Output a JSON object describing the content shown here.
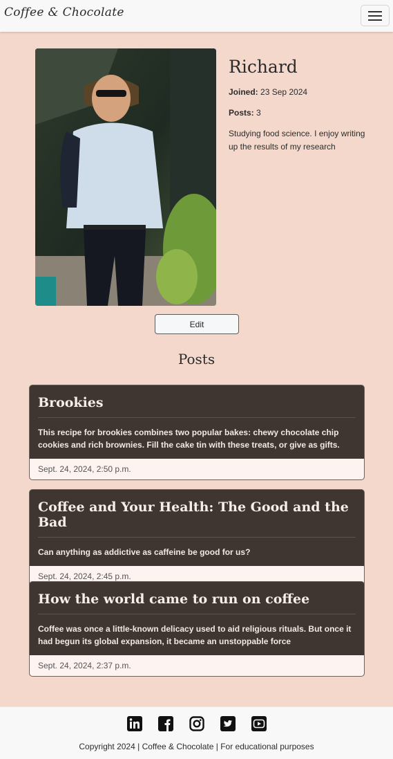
{
  "navbar": {
    "brand": "Coffee & Chocolate",
    "toggler_icon": "hamburger-icon"
  },
  "profile": {
    "name": "Richard",
    "joined_label": "Joined:",
    "joined_value": "23 Sep 2024",
    "posts_label": "Posts:",
    "posts_value": "3",
    "bio": "Studying food science. I enjoy writing up the results of my research",
    "edit_label": "Edit"
  },
  "posts_heading": "Posts",
  "posts": [
    {
      "title": "Brookies",
      "excerpt": "This recipe for brookies combines two popular bakes: chewy chocolate chip cookies and rich brownies. Fill the cake tin with these treats, or give as gifts.",
      "date": "Sept. 24, 2024, 2:50 p.m."
    },
    {
      "title": "Coffee and Your Health: The Good and the Bad",
      "excerpt": "Can anything as addictive as caffeine be good for us?",
      "date": "Sept. 24, 2024, 2:45 p.m."
    },
    {
      "title": "How the world came to run on coffee",
      "excerpt": "Coffee was once a little-known delicacy used to aid religious rituals. But once it had begun its global expansion, it became an unstoppable force",
      "date": "Sept. 24, 2024, 2:37 p.m."
    }
  ],
  "footer": {
    "socials": [
      "linkedin-icon",
      "facebook-icon",
      "instagram-icon",
      "twitter-icon",
      "youtube-icon"
    ],
    "copyright": "Copyright 2024 | Coffee & Chocolate | For educational purposes"
  },
  "colors": {
    "page_background": "#f3d8cb",
    "card_background": "#3f3531",
    "card_footer": "#fdf3f0",
    "navbar": "#f8f8f8"
  }
}
